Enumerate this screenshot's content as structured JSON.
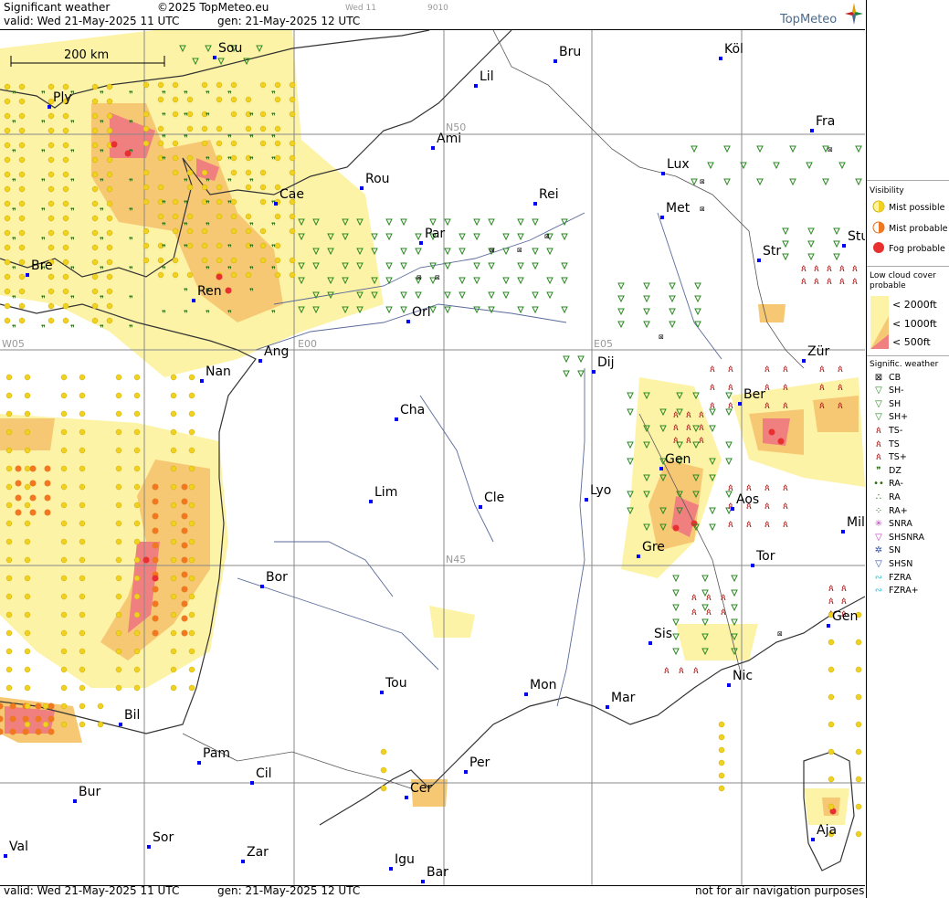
{
  "header": {
    "title": "Significant weather",
    "copyright": "©2025 TopMeteo.eu",
    "day_small": "Wed 11",
    "code_small": "9010",
    "valid": "valid:  Wed  21-May-2025  11 UTC",
    "gen": "gen: 21-May-2025 12 UTC",
    "logo": "TopMeteo"
  },
  "footer": {
    "valid": "valid:  Wed  21-May-2025  11 UTC",
    "gen": "gen: 21-May-2025 12 UTC",
    "disclaimer": "not for air navigation purposes"
  },
  "scale_label": "200 km",
  "grid_labels": {
    "n50": "N50",
    "n45": "N45",
    "w05": "W05",
    "e00": "E00",
    "e05": "E05"
  },
  "cities": [
    {
      "name": "Sou"
    },
    {
      "name": "Ply"
    },
    {
      "name": "Lil"
    },
    {
      "name": "Bru"
    },
    {
      "name": "Köl"
    },
    {
      "name": "Ami"
    },
    {
      "name": "Fra"
    },
    {
      "name": "Rou"
    },
    {
      "name": "Lux"
    },
    {
      "name": "Cae"
    },
    {
      "name": "Rei"
    },
    {
      "name": "Met"
    },
    {
      "name": "Par"
    },
    {
      "name": "Bre"
    },
    {
      "name": "Str"
    },
    {
      "name": "Stu"
    },
    {
      "name": "Ren"
    },
    {
      "name": "Orl"
    },
    {
      "name": "Ang"
    },
    {
      "name": "Nan"
    },
    {
      "name": "Dij"
    },
    {
      "name": "Zür"
    },
    {
      "name": "Cha"
    },
    {
      "name": "Ber"
    },
    {
      "name": "Gen"
    },
    {
      "name": "Lim"
    },
    {
      "name": "Cle"
    },
    {
      "name": "Lyo"
    },
    {
      "name": "Aos"
    },
    {
      "name": "Mil"
    },
    {
      "name": "Gre"
    },
    {
      "name": "Tor"
    },
    {
      "name": "Bor"
    },
    {
      "name": "Gen"
    },
    {
      "name": "Sis"
    },
    {
      "name": "Nic"
    },
    {
      "name": "Tou"
    },
    {
      "name": "Mon"
    },
    {
      "name": "Mar"
    },
    {
      "name": "Bil"
    },
    {
      "name": "Pam"
    },
    {
      "name": "Cil"
    },
    {
      "name": "Per"
    },
    {
      "name": "Bur"
    },
    {
      "name": "Cer"
    },
    {
      "name": "Sor"
    },
    {
      "name": "Aja"
    },
    {
      "name": "Val"
    },
    {
      "name": "Zar"
    },
    {
      "name": "Igu"
    },
    {
      "name": "Bar"
    }
  ],
  "legend": {
    "visibility_title": "Visibility",
    "mist_possible": "Mist possible",
    "mist_probable": "Mist probable",
    "fog_probable": "Fog probable",
    "lowcloud_title": "Low cloud cover probable",
    "lc_2000": "< 2000ft",
    "lc_1000": "< 1000ft",
    "lc_500": "<  500ft",
    "signif_title": "Signific. weather",
    "items": [
      "CB",
      "SH-",
      "SH",
      "SH+",
      "TS-",
      "TS",
      "TS+",
      "DZ",
      "RA-",
      "RA",
      "RA+",
      "SNRA",
      "SHSNRA",
      "SN",
      "SHSN",
      "FZRA",
      "FZRA+"
    ]
  },
  "colors": {
    "low2000": "#fdf3a6",
    "low1000": "#f7c873",
    "low500": "#f08080",
    "mist": "#f0d020",
    "fog": "#e83030",
    "shower": "#2a8a20",
    "ts": "#b02020",
    "city_dot": "#0000ff"
  }
}
